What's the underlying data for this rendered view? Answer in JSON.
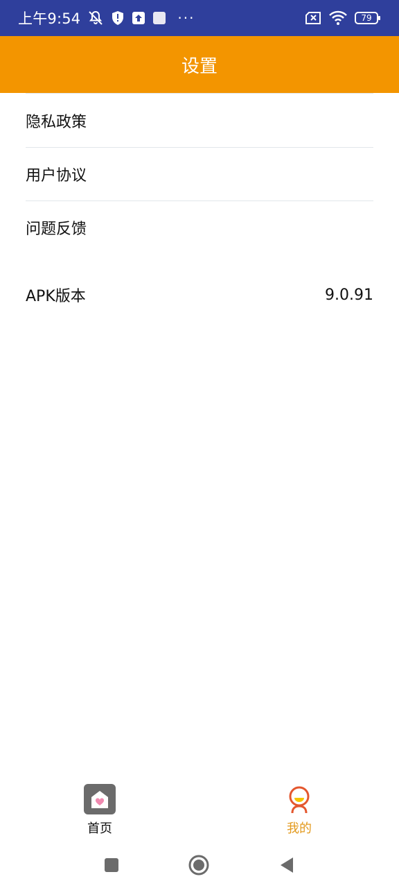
{
  "status_bar": {
    "time": "上午9:54",
    "battery": "79",
    "icons": [
      "muted-bell-icon",
      "shield-icon",
      "upload-icon",
      "app-square-icon",
      "more-dots-icon",
      "no-sim-icon",
      "wifi-icon",
      "battery-icon"
    ],
    "more": "···"
  },
  "app_bar": {
    "title": "设置"
  },
  "settings": {
    "items": [
      {
        "label": "隐私政策"
      },
      {
        "label": "用户协议"
      },
      {
        "label": "问题反馈"
      }
    ],
    "version": {
      "label": "APK版本",
      "value": "9.0.91"
    }
  },
  "bottom_nav": {
    "tabs": [
      {
        "label": "首页",
        "icon": "home-icon",
        "active": false
      },
      {
        "label": "我的",
        "icon": "profile-icon",
        "active": true
      }
    ],
    "active_color": "#e39a1e"
  },
  "colors": {
    "status_bar": "#2f3f9c",
    "app_bar": "#f39500"
  }
}
